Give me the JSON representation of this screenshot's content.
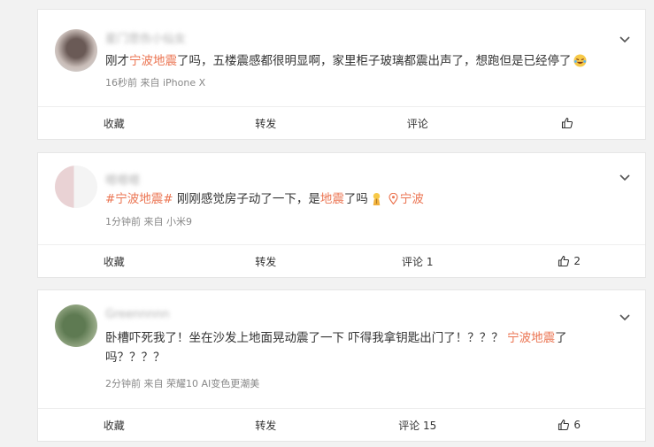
{
  "posts": [
    {
      "username": "星门悲伤小仙女",
      "text_before": "刚才",
      "tag": "宁波地震",
      "text_after": "了吗，五楼震感都很明显啊，家里柜子玻璃都震出声了，想跑但是已经停了",
      "emoji_icon": "laugh-cry-emoji",
      "meta": "16秒前 来自 iPhone X",
      "actions": {
        "collect": "收藏",
        "repost": "转发",
        "comment": "评论",
        "like": ""
      }
    },
    {
      "username": "嗯嗯嗯",
      "hashtag": "#宁波地震#",
      "text_middle": " 刚刚感觉房子动了一下，是",
      "keyword": "地震",
      "text_after": "了吗",
      "emoji_icon": "pray-emoji",
      "location": "宁波",
      "meta": "1分钟前 来自 小米9",
      "actions": {
        "collect": "收藏",
        "repost": "转发",
        "comment": "评论 1",
        "like": "2"
      }
    },
    {
      "username": "Greennnnn",
      "text_before": "卧槽吓死我了！坐在沙发上地面晃动震了一下 吓得我拿钥匙出门了！？？？ ",
      "tag": "宁波地震",
      "text_after": "了吗？？？？",
      "meta": "2分钟前 来自 荣耀10 AI变色更潮美",
      "actions": {
        "collect": "收藏",
        "repost": "转发",
        "comment": "评论 15",
        "like": "6"
      }
    }
  ],
  "colors": {
    "highlight": "#eb7350",
    "meta": "#888888",
    "background": "#f2f2f2"
  }
}
